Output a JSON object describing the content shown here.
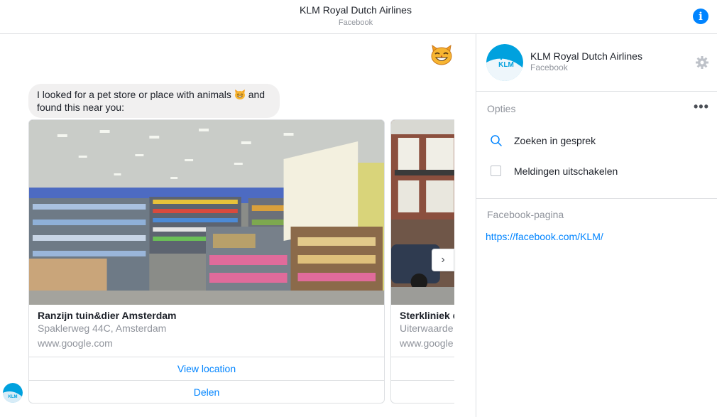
{
  "header": {
    "title": "KLM Royal Dutch Airlines",
    "subtitle": "Facebook"
  },
  "chat": {
    "message_text_1": "I looked for a pet store or place with animals",
    "message_text_2": "and found this near you:",
    "cards": [
      {
        "title": "Ranzijn tuin&dier Amsterdam",
        "address": "Spaklerweg 44C, Amsterdam",
        "url": "www.google.com",
        "button_1": "View location",
        "button_2": "Delen"
      },
      {
        "title": "Sterkliniek d",
        "address": "Uiterwaarde",
        "url": "www.google",
        "button_1": "",
        "button_2": ""
      }
    ]
  },
  "panel": {
    "name": "KLM Royal Dutch Airlines",
    "subtitle": "Facebook",
    "options_header": "Opties",
    "search_label": "Zoeken in gesprek",
    "mute_label": "Meldingen uitschakelen",
    "facebook_page_header": "Facebook-pagina",
    "facebook_page_url": "https://facebook.com/KLM/"
  },
  "avatar_text": "KLM",
  "colors": {
    "accent": "#0084ff",
    "bubble_bg": "#f1f0f0",
    "muted_text": "#90949c",
    "border": "#dddfe2"
  },
  "icons": {
    "info": "info-icon",
    "gear": "gear-icon",
    "search": "search-icon",
    "next": "chevron-right-icon",
    "cat": "cat-face-emoji",
    "more": "more-dots-icon"
  }
}
